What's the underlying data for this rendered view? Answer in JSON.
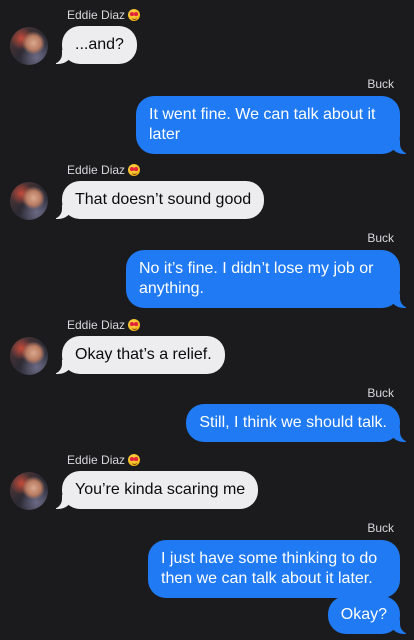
{
  "contact": {
    "name": "Eddie Diaz",
    "emoji": "heart-eyes-emoji"
  },
  "me": {
    "name": "Buck"
  },
  "colors": {
    "background": "#1b1b1d",
    "incoming_bubble": "#ededf0",
    "outgoing_bubble": "#1f7af3"
  },
  "messages": [
    {
      "from": "Eddie Diaz",
      "text": "...and?"
    },
    {
      "from": "Buck",
      "text": "It went fine. We can talk about it later"
    },
    {
      "from": "Eddie Diaz",
      "text": "That doesn’t sound good"
    },
    {
      "from": "Buck",
      "text": "No it’s fine. I didn’t lose my job or anything."
    },
    {
      "from": "Eddie Diaz",
      "text": "Okay that’s a relief."
    },
    {
      "from": "Buck",
      "text": "Still, I think we should talk."
    },
    {
      "from": "Eddie Diaz",
      "text": "You’re kinda scaring me"
    },
    {
      "from": "Buck",
      "text": "I just have some thinking to do then we can talk about it later."
    },
    {
      "from": "Buck",
      "text": "Okay?"
    }
  ]
}
